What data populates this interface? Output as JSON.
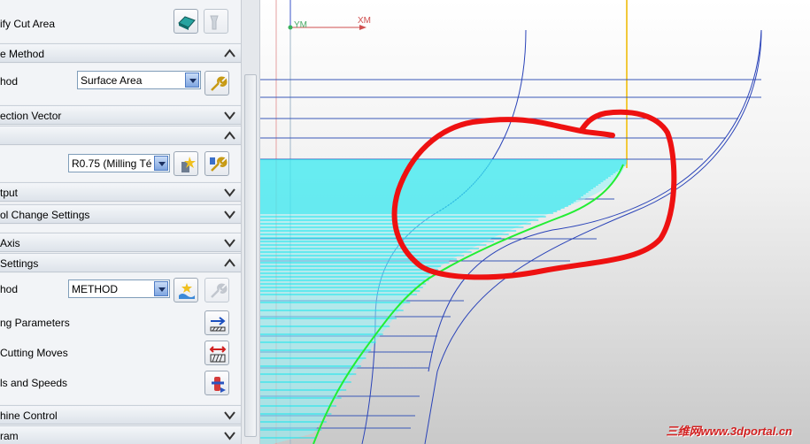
{
  "panel": {
    "specify_cut_area_label": "ify Cut Area",
    "sections": {
      "drive_method": "e Method",
      "projection_vector": "ection Vector",
      "tool_output": "tput",
      "tool_change": "ol Change Settings",
      "tool_axis": "Axis",
      "path_settings": "Settings",
      "machine_control": "hine Control",
      "program": "ram"
    },
    "method_label": "hod",
    "method_value": "Surface Area",
    "tool_value": "R0.75 (Milling Té",
    "path_method_label": "hod",
    "path_method_value": "METHOD",
    "cutting_parameters": "ng Parameters",
    "non_cutting_moves": "Cutting Moves",
    "feeds_speeds": "ls and Speeds"
  },
  "viewport": {
    "axis_y": "YM",
    "axis_x": "XM",
    "colors": {
      "toolpath_cyan": "#12e6ee",
      "curve_blue": "#2a43b8",
      "contact_green": "#22ee33",
      "annotation_red": "#ee1111",
      "axis_yellow": "#f2c93a"
    },
    "watermark": "三维网www.3dportal.cn"
  }
}
